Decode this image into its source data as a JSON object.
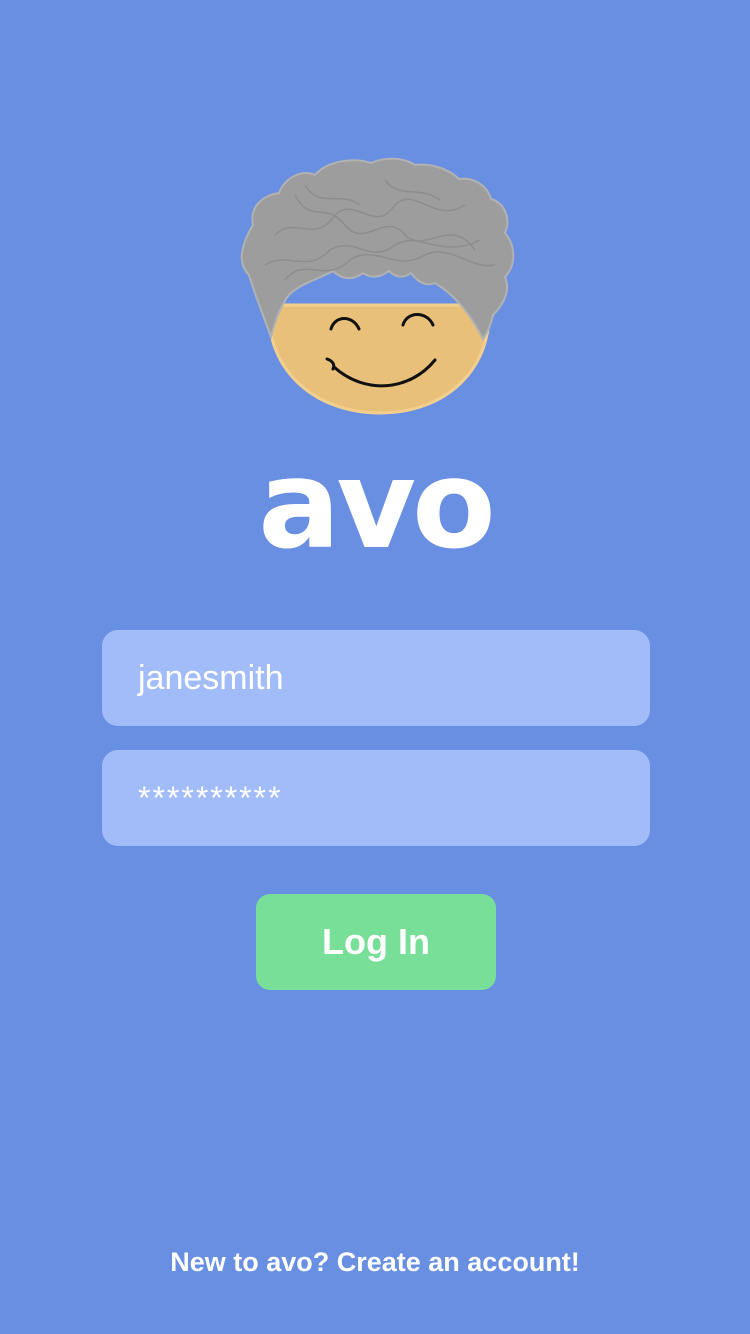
{
  "app": {
    "name": "avo",
    "background_color": "#698fe2"
  },
  "avatar": {
    "icon": "smiling-face-avatar-icon",
    "face_color": "#e9c07a",
    "hair_color": "#9d9d9d"
  },
  "login_form": {
    "username_value": "janesmith",
    "password_value": "**********",
    "field_color": "#a2bcf9",
    "login_label": "Log In",
    "login_color": "#77df98"
  },
  "footer": {
    "signup_text": "New to avo? Create an account!"
  }
}
